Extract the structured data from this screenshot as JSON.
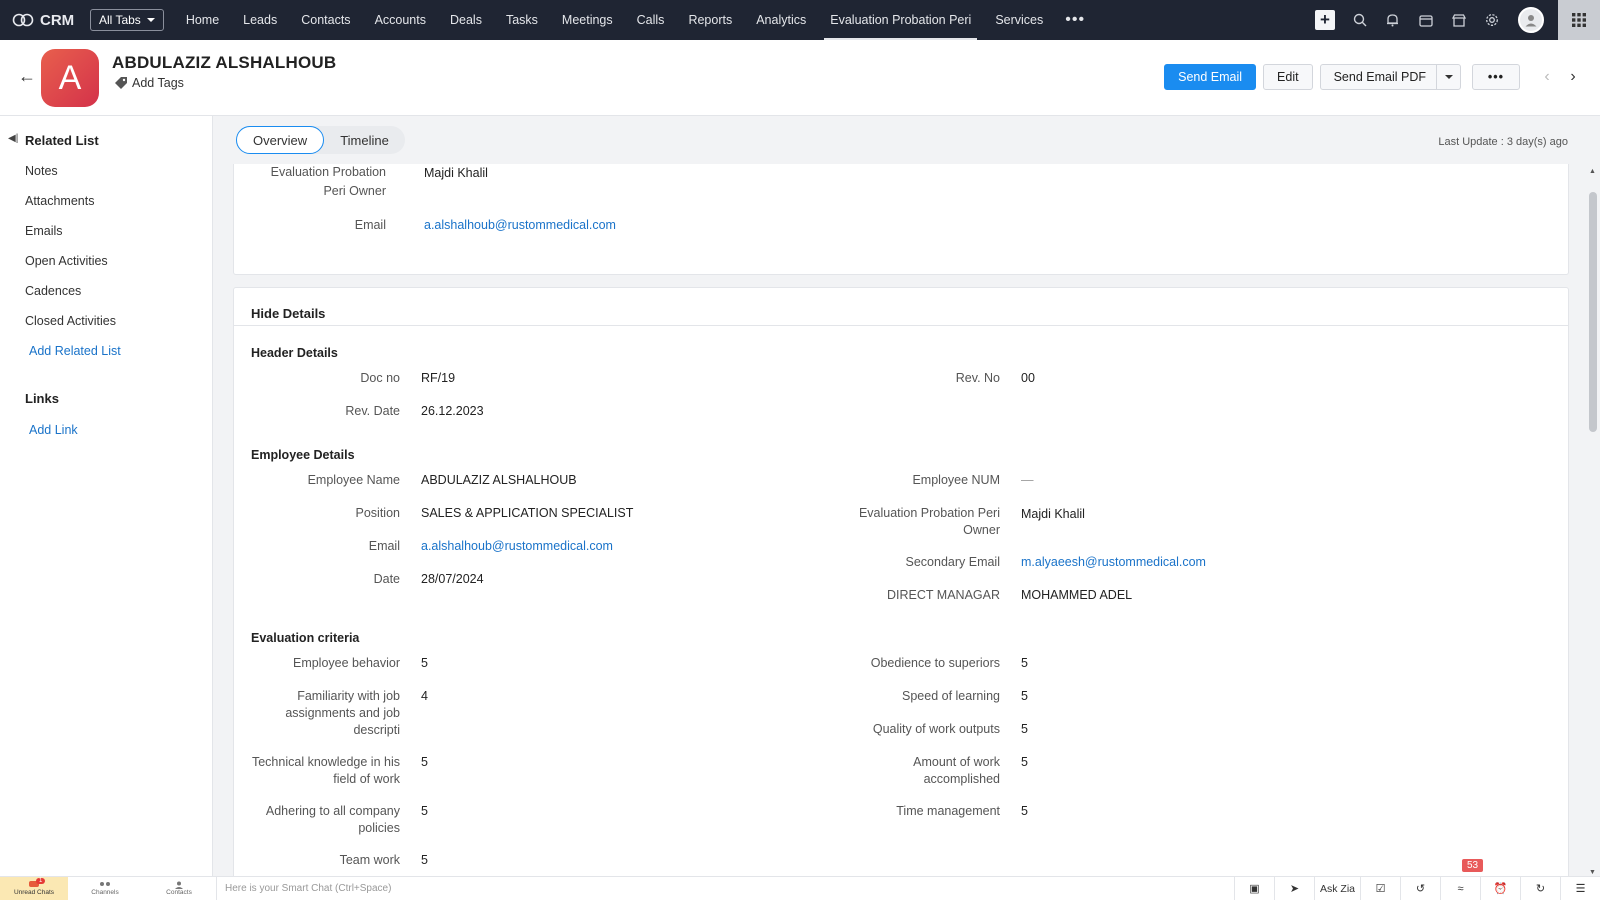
{
  "app": {
    "brand": "CRM",
    "all_tabs": "All Tabs"
  },
  "nav": {
    "tabs": [
      {
        "label": "Home"
      },
      {
        "label": "Leads"
      },
      {
        "label": "Contacts"
      },
      {
        "label": "Accounts"
      },
      {
        "label": "Deals"
      },
      {
        "label": "Tasks"
      },
      {
        "label": "Meetings"
      },
      {
        "label": "Calls"
      },
      {
        "label": "Reports"
      },
      {
        "label": "Analytics"
      },
      {
        "label": "Evaluation Probation Peri"
      },
      {
        "label": "Services"
      }
    ],
    "active_tab": "Evaluation Probation Peri",
    "more": "•••",
    "right_icons": [
      "plus-icon",
      "search-icon",
      "bell-icon",
      "calendar-icon",
      "marketplace-icon",
      "gear-icon",
      "avatar",
      "apps-grid-icon"
    ]
  },
  "record": {
    "avatar_letter": "A",
    "name": "ABDULAZIZ ALSHALHOUB",
    "add_tags": "Add Tags",
    "actions": {
      "send_email": "Send Email",
      "edit": "Edit",
      "send_email_pdf": "Send Email PDF",
      "more": "•••"
    },
    "avatar_color": "#e0454b"
  },
  "sidebar": {
    "related_title": "Related List",
    "items": [
      {
        "label": "Notes"
      },
      {
        "label": "Attachments"
      },
      {
        "label": "Emails"
      },
      {
        "label": "Open Activities"
      },
      {
        "label": "Cadences"
      },
      {
        "label": "Closed Activities"
      }
    ],
    "add_related": "Add Related List",
    "links_title": "Links",
    "add_link": "Add Link"
  },
  "main": {
    "tabs": [
      {
        "label": "Overview"
      },
      {
        "label": "Timeline"
      }
    ],
    "last_update": "Last Update : 3 day(s) ago",
    "top_card": {
      "owner_label_1": "Evaluation Probation",
      "owner_label_2": "Peri Owner",
      "owner_value": "Majdi Khalil",
      "email_label": "Email",
      "email_value": "a.alshalhoub@rustommedical.com"
    },
    "details": {
      "hide_details": "Hide Details",
      "header_title": "Header Details",
      "doc_no_label": "Doc no",
      "doc_no": "RF/19",
      "rev_no_label": "Rev. No",
      "rev_no": "00",
      "rev_date_label": "Rev. Date",
      "rev_date": "26.12.2023",
      "employee_title": "Employee Details",
      "emp_name_label": "Employee Name",
      "emp_name": "ABDULAZIZ ALSHALHOUB",
      "emp_num_label": "Employee NUM",
      "emp_num": "—",
      "position_label": "Position",
      "position": "SALES & APPLICATION SPECIALIST",
      "owner_label_1": "Evaluation Probation Peri",
      "owner_label_2": "Owner",
      "owner": "Majdi Khalil",
      "email_label": "Email",
      "email": "a.alshalhoub@rustommedical.com",
      "secondary_email_label": "Secondary Email",
      "secondary_email": "m.alyaeesh@rustommedical.com",
      "date_label": "Date",
      "date": "28/07/2024",
      "manager_label": "DIRECT MANAGAR",
      "manager": "MOHAMMED ADEL",
      "criteria_title": "Evaluation criteria",
      "behavior_label": "Employee behavior",
      "behavior": "5",
      "obedience_label": "Obedience to superiors",
      "obedience": "5",
      "familiarity_label_1": "Familiarity with job",
      "familiarity_label_2": "assignments and job",
      "familiarity_label_3": "descripti",
      "familiarity": "4",
      "speed_label": "Speed of learning",
      "speed": "5",
      "quality_label": "Quality of work outputs",
      "quality": "5",
      "technical_label_1": "Technical knowledge in his",
      "technical_label_2": "field of work",
      "technical": "5",
      "amount_label_1": "Amount of work",
      "amount_label_2": "accomplished",
      "amount": "5",
      "adhering_label_1": "Adhering to all company",
      "adhering_label_2": "policies",
      "adhering": "5",
      "time_label": "Time management",
      "time": "5",
      "teamwork_label": "Team work",
      "teamwork": "5"
    }
  },
  "bottom": {
    "unread_chats": "Unread Chats",
    "unread_badge": "1",
    "channels": "Channels",
    "contacts": "Contacts",
    "smart_chat": "Here is your Smart Chat (Ctrl+Space)",
    "ask_zia": "Ask Zia",
    "notif_count": "53"
  }
}
